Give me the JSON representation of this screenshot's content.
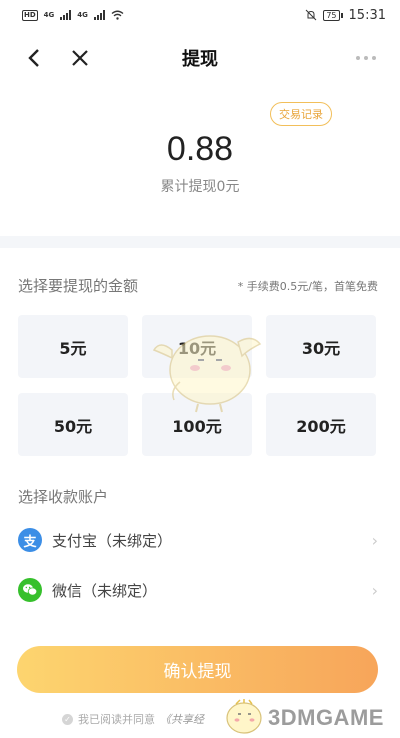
{
  "status_bar": {
    "hd_label": "HD",
    "hd_sub": "2",
    "net1": "4G",
    "net2": "4G",
    "battery": "75",
    "time": "15:31"
  },
  "nav": {
    "title": "提现"
  },
  "balance": {
    "records_label": "交易记录",
    "amount": "0.88",
    "total_label": "累计提现0元"
  },
  "amount_section": {
    "title": "选择要提现的金额",
    "fee_note": "* 手续费0.5元/笔，首笔免费",
    "options": [
      {
        "label": "5元"
      },
      {
        "label": "10元"
      },
      {
        "label": "30元"
      },
      {
        "label": "50元"
      },
      {
        "label": "100元"
      },
      {
        "label": "200元"
      }
    ]
  },
  "account_section": {
    "title": "选择收款账户",
    "accounts": [
      {
        "label": "支付宝（未绑定）",
        "icon": "alipay-icon",
        "icon_char": "支",
        "color": "#3c8ee6"
      },
      {
        "label": "微信（未绑定）",
        "icon": "wechat-icon",
        "icon_char": "✉",
        "color": "#36c02c"
      }
    ]
  },
  "confirm_label": "确认提现",
  "agreement": {
    "text": "我已阅读并同意",
    "link": "《共享经"
  },
  "watermark": {
    "text": "3DMGAME"
  },
  "colors": {
    "accent_start": "#fdd56f",
    "accent_end": "#f7a55a",
    "records_border": "#f2bf5a"
  }
}
